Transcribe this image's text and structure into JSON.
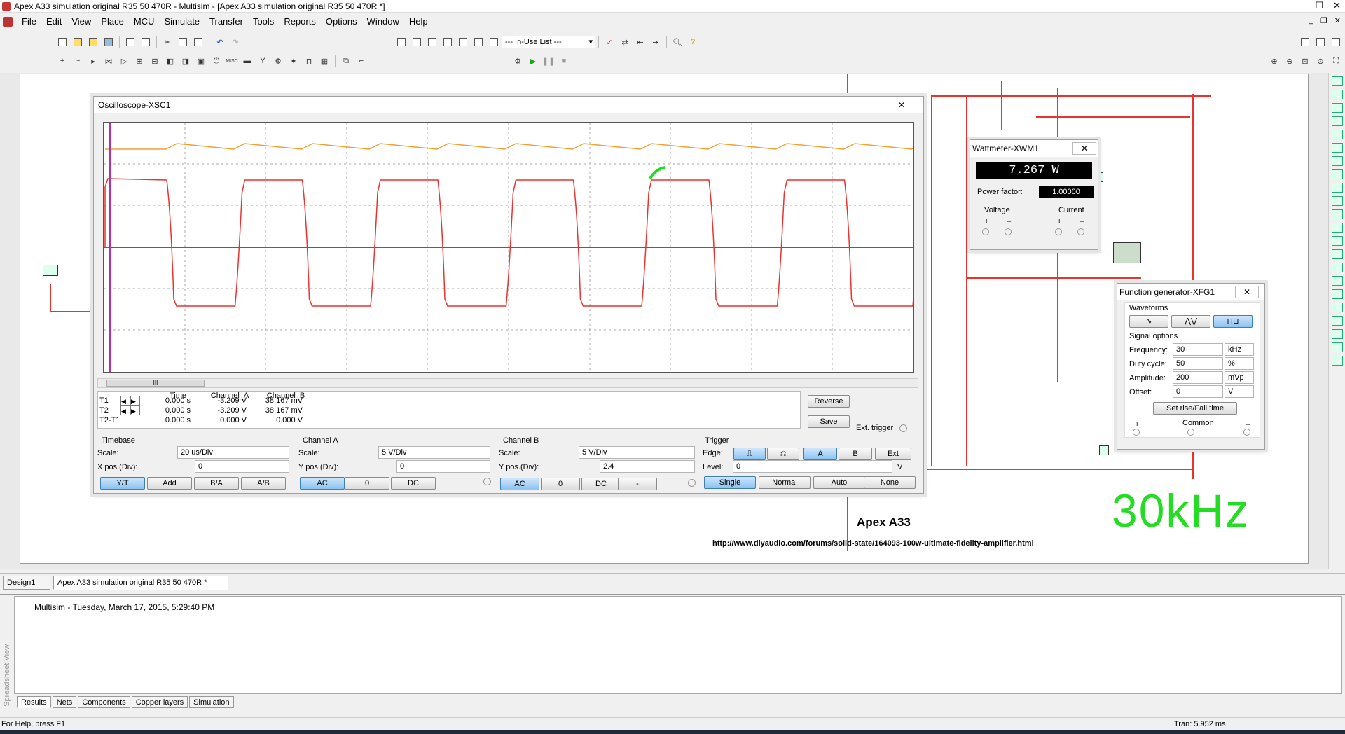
{
  "window": {
    "title": "Apex A33 simulation original R35 50 470R - Multisim - [Apex A33 simulation original R35 50 470R *]",
    "controls": [
      "—",
      "☐",
      "✕"
    ]
  },
  "menu": [
    "File",
    "Edit",
    "View",
    "Place",
    "MCU",
    "Simulate",
    "Transfer",
    "Tools",
    "Reports",
    "Options",
    "Window",
    "Help"
  ],
  "toolbar": {
    "in_use_list": "--- In-Use List ---"
  },
  "oscilloscope": {
    "title": "Oscilloscope-XSC1",
    "close": "✕",
    "readout": {
      "headers": [
        "Time",
        "Channel_A",
        "Channel_B"
      ],
      "rows": [
        {
          "label": "T1",
          "time": "0.000 s",
          "a": "-3.209 V",
          "b": "38.167 mV"
        },
        {
          "label": "T2",
          "time": "0.000 s",
          "a": "-3.209 V",
          "b": "38.167 mV"
        },
        {
          "label": "T2-T1",
          "time": "0.000 s",
          "a": "0.000 V",
          "b": "0.000 V"
        }
      ]
    },
    "reverse": "Reverse",
    "save": "Save",
    "ext_trigger": "Ext. trigger",
    "timebase": {
      "title": "Timebase",
      "scale_label": "Scale:",
      "scale": "20 us/Div",
      "xpos_label": "X pos.(Div):",
      "xpos": "0",
      "buttons": [
        "Y/T",
        "Add",
        "B/A",
        "A/B"
      ]
    },
    "channel_a": {
      "title": "Channel A",
      "scale_label": "Scale:",
      "scale": "5  V/Div",
      "ypos_label": "Y pos.(Div):",
      "ypos": "0",
      "buttons": [
        "AC",
        "0",
        "DC"
      ]
    },
    "channel_b": {
      "title": "Channel B",
      "scale_label": "Scale:",
      "scale": "5  V/Div",
      "ypos_label": "Y pos.(Div):",
      "ypos": "2.4",
      "buttons": [
        "AC",
        "0",
        "DC",
        "-"
      ]
    },
    "trigger": {
      "title": "Trigger",
      "edge_label": "Edge:",
      "level_label": "Level:",
      "level": "0",
      "level_unit": "V",
      "sources": [
        "A",
        "B",
        "Ext"
      ],
      "modes": [
        "Single",
        "Normal",
        "Auto",
        "None"
      ]
    },
    "scroll_thumb": "III"
  },
  "wattmeter": {
    "title": "Wattmeter-XWM1",
    "close": "✕",
    "power": "7.267 W",
    "pf_label": "Power factor:",
    "pf": "1.00000",
    "voltage": "Voltage",
    "current": "Current",
    "plus": "+",
    "minus": "–"
  },
  "function_generator": {
    "title": "Function generator-XFG1",
    "close": "✕",
    "waveforms_label": "Waveforms",
    "signal_options": "Signal options",
    "frequency_label": "Frequency:",
    "frequency": "30",
    "frequency_unit": "kHz",
    "duty_label": "Duty cycle:",
    "duty": "50",
    "duty_unit": "%",
    "amplitude_label": "Amplitude:",
    "amplitude": "200",
    "amplitude_unit": "mVp",
    "offset_label": "Offset:",
    "offset": "0",
    "offset_unit": "V",
    "rise_fall": "Set rise/Fall time",
    "plus": "+",
    "common": "Common",
    "minus": "–"
  },
  "schematic": {
    "title": "Apex A33",
    "url": "http://www.diyaudio.com/forums/solid-state/164093-100w-ultimate-fidelity-amplifier.html",
    "annotation": "30kHz"
  },
  "doc_tabs": [
    "Design1",
    "Apex A33 simulation original R35 50 470R *"
  ],
  "spreadsheet": {
    "side_label": "Spreadsheet View",
    "log": "Multisim  -  Tuesday, March 17, 2015, 5:29:40 PM",
    "tabs": [
      "Results",
      "Nets",
      "Components",
      "Copper layers",
      "Simulation"
    ]
  },
  "status": {
    "help": "For Help, press F1",
    "tran": "Tran: 5.952 ms"
  },
  "colors": {
    "channel_a": "#e8332f",
    "channel_b": "#f0a030",
    "annotation": "#22dd22",
    "wire": "#e8332f"
  }
}
